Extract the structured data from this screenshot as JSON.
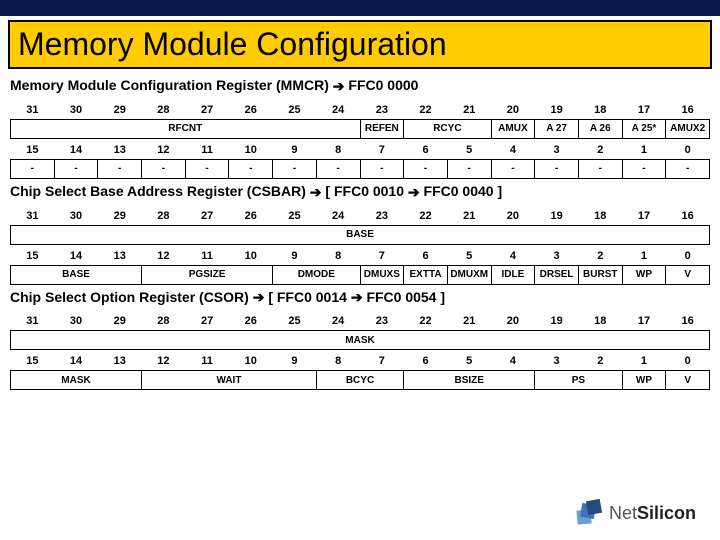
{
  "title": "Memory Module Configuration",
  "logo": {
    "name_part1": "Net",
    "name_part2": "Silicon"
  },
  "mmcr": {
    "heading_pre": "Memory Module Configuration Register (MMCR) ",
    "heading_post": " FFC0 0000",
    "bits_hi": [
      "31",
      "30",
      "29",
      "28",
      "27",
      "26",
      "25",
      "24",
      "23",
      "22",
      "21",
      "20",
      "19",
      "18",
      "17",
      "16"
    ],
    "row_hi_fields": [
      {
        "span": 8,
        "label": "RFCNT"
      },
      {
        "span": 1,
        "label": "REFEN"
      },
      {
        "span": 2,
        "label": "RCYC"
      },
      {
        "span": 1,
        "label": "AMUX"
      },
      {
        "span": 1,
        "label": "A 27"
      },
      {
        "span": 1,
        "label": "A 26"
      },
      {
        "span": 1,
        "label": "A 25*"
      },
      {
        "span": 1,
        "label": "AMUX2"
      }
    ],
    "bits_lo": [
      "15",
      "14",
      "13",
      "12",
      "11",
      "10",
      "9",
      "8",
      "7",
      "6",
      "5",
      "4",
      "3",
      "2",
      "1",
      "0"
    ],
    "row_lo_fields": [
      {
        "span": 1,
        "label": "-"
      },
      {
        "span": 1,
        "label": "-"
      },
      {
        "span": 1,
        "label": "-"
      },
      {
        "span": 1,
        "label": "-"
      },
      {
        "span": 1,
        "label": "-"
      },
      {
        "span": 1,
        "label": "-"
      },
      {
        "span": 1,
        "label": "-"
      },
      {
        "span": 1,
        "label": "-"
      },
      {
        "span": 1,
        "label": "-"
      },
      {
        "span": 1,
        "label": "-"
      },
      {
        "span": 1,
        "label": "-"
      },
      {
        "span": 1,
        "label": "-"
      },
      {
        "span": 1,
        "label": "-"
      },
      {
        "span": 1,
        "label": "-"
      },
      {
        "span": 1,
        "label": "-"
      },
      {
        "span": 1,
        "label": "-"
      }
    ]
  },
  "csbar": {
    "heading_pre": "Chip Select Base Address Register (CSBAR) ",
    "heading_mid": " [ FFC0 0010 ",
    "heading_post": " FFC0 0040 ]",
    "bits_hi": [
      "31",
      "30",
      "29",
      "28",
      "27",
      "26",
      "25",
      "24",
      "23",
      "22",
      "21",
      "20",
      "19",
      "18",
      "17",
      "16"
    ],
    "row_hi_fields": [
      {
        "span": 16,
        "label": "BASE"
      }
    ],
    "bits_lo": [
      "15",
      "14",
      "13",
      "12",
      "11",
      "10",
      "9",
      "8",
      "7",
      "6",
      "5",
      "4",
      "3",
      "2",
      "1",
      "0"
    ],
    "row_lo_fields": [
      {
        "span": 3,
        "label": "BASE"
      },
      {
        "span": 3,
        "label": "PGSIZE"
      },
      {
        "span": 2,
        "label": "DMODE"
      },
      {
        "span": 1,
        "label": "DMUXS"
      },
      {
        "span": 1,
        "label": "EXTTA"
      },
      {
        "span": 1,
        "label": "DMUXM"
      },
      {
        "span": 1,
        "label": "IDLE"
      },
      {
        "span": 1,
        "label": "DRSEL"
      },
      {
        "span": 1,
        "label": "BURST"
      },
      {
        "span": 1,
        "label": "WP"
      },
      {
        "span": 1,
        "label": "V"
      }
    ]
  },
  "csor": {
    "heading_pre": "Chip Select Option Register (CSOR) ",
    "heading_mid": " [ FFC0 0014 ",
    "heading_post": " FFC0 0054 ]",
    "bits_hi": [
      "31",
      "30",
      "29",
      "28",
      "27",
      "26",
      "25",
      "24",
      "23",
      "22",
      "21",
      "20",
      "19",
      "18",
      "17",
      "16"
    ],
    "row_hi_fields": [
      {
        "span": 16,
        "label": "MASK"
      }
    ],
    "bits_lo": [
      "15",
      "14",
      "13",
      "12",
      "11",
      "10",
      "9",
      "8",
      "7",
      "6",
      "5",
      "4",
      "3",
      "2",
      "1",
      "0"
    ],
    "row_lo_fields": [
      {
        "span": 3,
        "label": "MASK"
      },
      {
        "span": 4,
        "label": "WAIT"
      },
      {
        "span": 2,
        "label": "BCYC"
      },
      {
        "span": 3,
        "label": "BSIZE"
      },
      {
        "span": 2,
        "label": "PS"
      },
      {
        "span": 1,
        "label": "WP"
      },
      {
        "span": 1,
        "label": "V"
      }
    ]
  }
}
